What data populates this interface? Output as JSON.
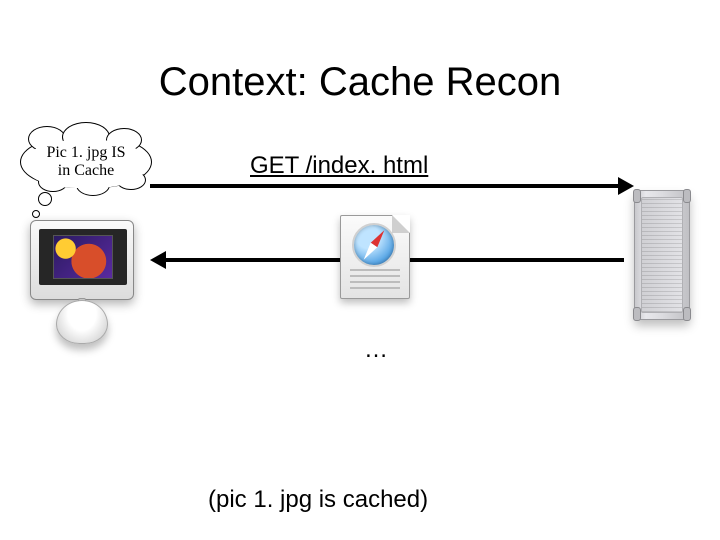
{
  "title": "Context: Cache Recon",
  "cloud": {
    "text": "Pic 1. jpg IS\nin Cache"
  },
  "requests": {
    "get": "GET /index. html"
  },
  "ellipsis": "…",
  "caption": "(pic 1. jpg is cached)",
  "icons": {
    "client": "imac-g4-icon",
    "server": "server-tower-icon",
    "file": "safari-html-file-icon"
  }
}
